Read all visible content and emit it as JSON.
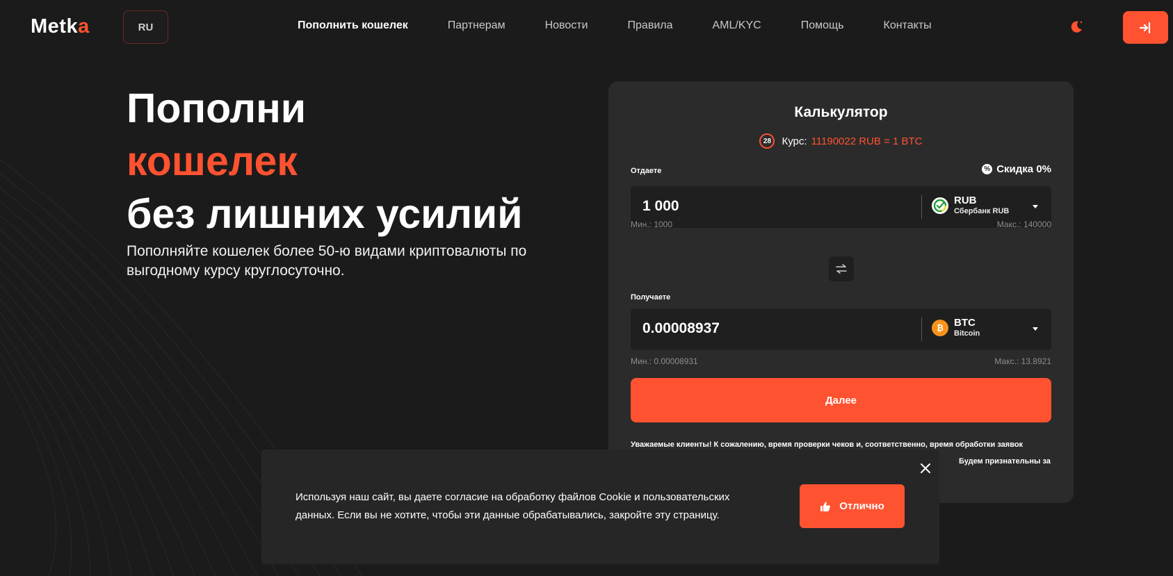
{
  "header": {
    "logo_main": "Metk",
    "logo_accent": "a",
    "language": "RU",
    "nav": [
      {
        "label": "Пополнить кошелек",
        "active": true
      },
      {
        "label": "Партнерам",
        "active": false
      },
      {
        "label": "Новости",
        "active": false
      },
      {
        "label": "Правила",
        "active": false
      },
      {
        "label": "AML/KYC",
        "active": false
      },
      {
        "label": "Помощь",
        "active": false
      },
      {
        "label": "Контакты",
        "active": false
      }
    ],
    "theme_icon": "moon-icon",
    "login_icon": "login-icon"
  },
  "hero": {
    "title_line1": "Пополни",
    "title_line2": "кошелек",
    "title_line3": "без лишних усилий",
    "subtitle": "Пополняйте кошелек более 50-ю видами криптовалюты по выгодному курсу круглосуточно."
  },
  "calculator": {
    "title": "Калькулятор",
    "timer": "28",
    "rate_label": "Курс:",
    "rate_value": "11190022 RUB = 1 BTC",
    "give_label": "Отдаете",
    "discount": "Скидка 0%",
    "give_amount": "1 000",
    "give_currency_code": "RUB",
    "give_currency_name": "Сбербанк RUB",
    "give_min": "Мин.: 1000",
    "give_max": "Макс.: 140000",
    "get_label": "Получаете",
    "get_amount": "0.00008937",
    "get_currency_code": "BTC",
    "get_currency_name": "Bitcoin",
    "get_min": "Мин.: 0.00008931",
    "get_max": "Макс.: 13.8921",
    "next_button": "Далее",
    "notice_line1": "Уважаемые клиенты! К сожалению, время проверки чеков и, соответственно, время обработки заявок",
    "notice_line2": "Будем признательны за"
  },
  "cookie": {
    "text": "Используя наш сайт, вы даете согласие на обработку файлов Cookie и пользовательских данных. Если вы не хотите, чтобы эти данные обрабатывались, закройте эту страницу.",
    "ok_button": "Отлично"
  },
  "colors": {
    "accent": "#ff5231",
    "background": "#1b1b1b",
    "card": "#2b2b2b",
    "sber_green": "#21a038",
    "bitcoin_orange": "#f7931a"
  }
}
